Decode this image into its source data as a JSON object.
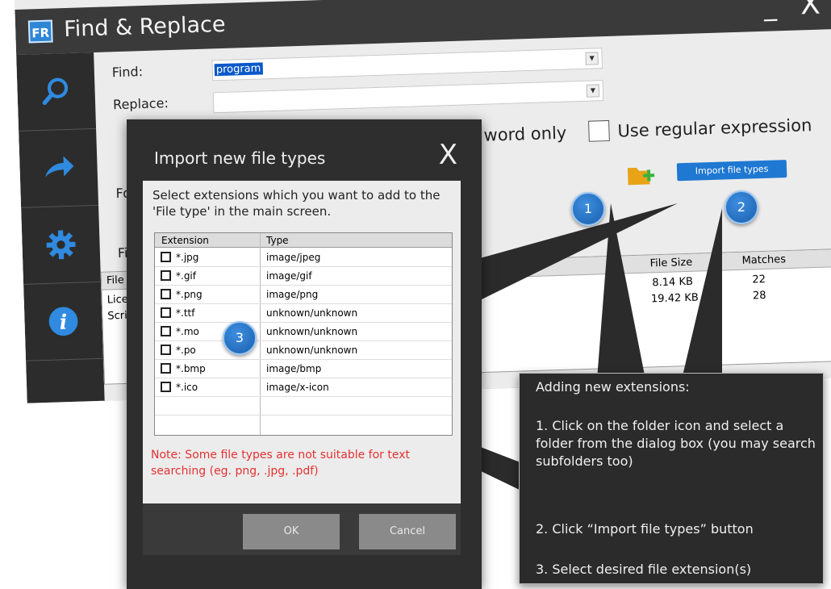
{
  "window": {
    "logo": "FR",
    "title": "Find & Replace",
    "minimize": "_",
    "close": "X"
  },
  "sidebar": {
    "items": [
      {
        "icon": "search-icon"
      },
      {
        "icon": "arrow-right-icon"
      },
      {
        "icon": "gear-icon"
      },
      {
        "icon": "info-icon"
      }
    ]
  },
  "form": {
    "find_label": "Find:",
    "find_value": "program",
    "replace_label": "Replace:",
    "replace_value": "",
    "whole_word_partial": "word only",
    "regex_label": "Use regular expression",
    "folder_label_partial": "Fo",
    "filetype_label_partial": "Fil",
    "import_button": "Import file types"
  },
  "results": {
    "headers": {
      "name_partial": "File n",
      "size": "File Size",
      "matches": "Matches"
    },
    "rows": [
      {
        "name_partial": "Licen",
        "size": "8.14 KB",
        "matches": "22"
      },
      {
        "name_partial": "Script",
        "size": "19.42 KB",
        "matches": "28"
      }
    ]
  },
  "dialog": {
    "title": "Import new file types",
    "close": "X",
    "instruction": "Select extensions which you want to add to the 'File type' in the main screen.",
    "columns": {
      "extension": "Extension",
      "type": "Type"
    },
    "rows": [
      {
        "ext": "*.jpg",
        "type": "image/jpeg"
      },
      {
        "ext": "*.gif",
        "type": "image/gif"
      },
      {
        "ext": "*.png",
        "type": "image/png"
      },
      {
        "ext": "*.ttf",
        "type": "unknown/unknown"
      },
      {
        "ext": "*.mo",
        "type": "unknown/unknown"
      },
      {
        "ext": "*.po",
        "type": "unknown/unknown"
      },
      {
        "ext": "*.bmp",
        "type": "image/bmp"
      },
      {
        "ext": "*.ico",
        "type": "image/x-icon"
      }
    ],
    "note": "Note: Some file types are not suitable for text searching (eg. png, .jpg, .pdf)",
    "ok": "OK",
    "cancel": "Cancel"
  },
  "badges": [
    "1",
    "2",
    "3"
  ],
  "callout": {
    "heading": "Adding new extensions:",
    "step1": "1. Click on the folder icon and select a folder from the dialog box (you may search subfolders too)",
    "step2": "2. Click “Import file types” button",
    "step3": "3. Select desired file extension(s)"
  },
  "colors": {
    "accent": "#1f78d1",
    "note": "#e53232",
    "dark": "#2e2e2e"
  }
}
